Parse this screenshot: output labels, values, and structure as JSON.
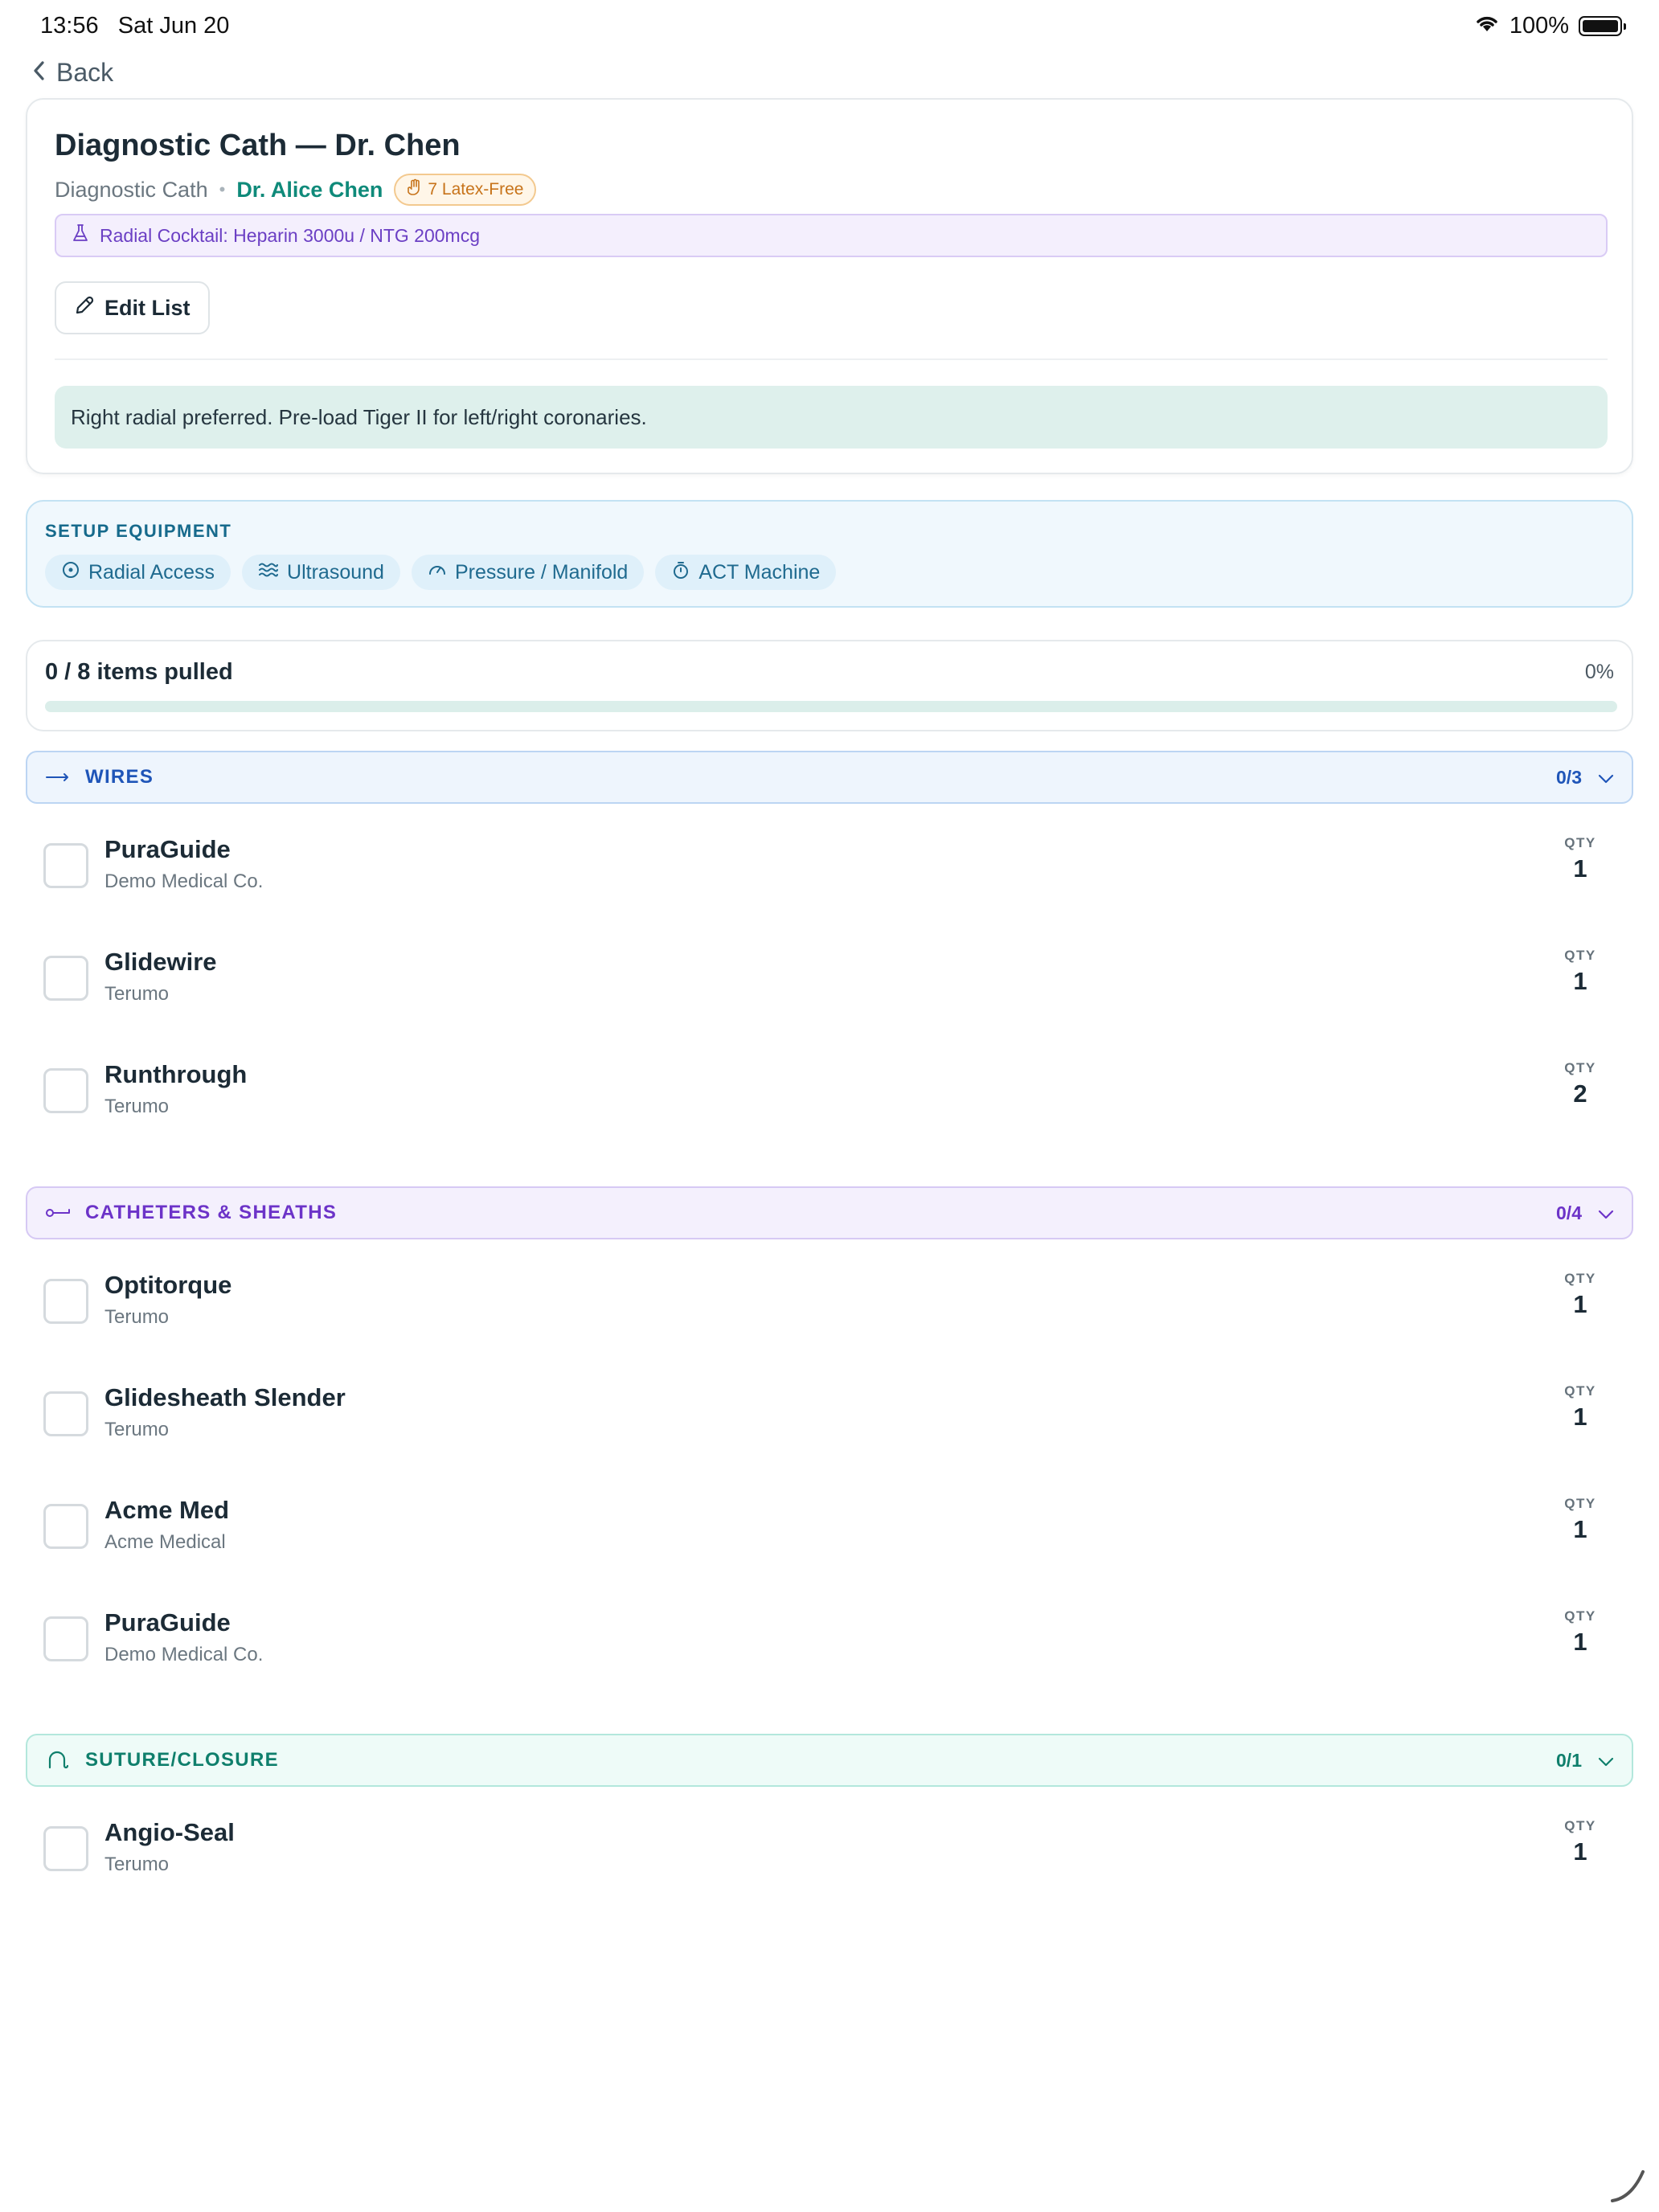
{
  "status_bar": {
    "time": "13:56",
    "date": "Sat Jun 20",
    "battery": "100%"
  },
  "nav": {
    "back_label": "Back"
  },
  "header": {
    "title": "Diagnostic Cath — Dr. Chen",
    "procedure_type": "Diagnostic Cath",
    "physician": "Dr. Alice Chen",
    "latex_badge": "7 Latex-Free",
    "cocktail": "Radial Cocktail: Heparin 3000u / NTG 200mcg",
    "edit_button": "Edit List",
    "note": "Right radial preferred. Pre-load Tiger II for left/right coronaries."
  },
  "setup_equipment": {
    "label": "SETUP EQUIPMENT",
    "chips": [
      {
        "label": "Radial Access",
        "icon": "circle-dot-icon"
      },
      {
        "label": "Ultrasound",
        "icon": "waves-icon"
      },
      {
        "label": "Pressure / Manifold",
        "icon": "gauge-icon"
      },
      {
        "label": "ACT Machine",
        "icon": "timer-icon"
      }
    ]
  },
  "progress": {
    "text": "0 / 8 items pulled",
    "percent_label": "0%",
    "fraction": 0
  },
  "qty_label": "QTY",
  "sections": [
    {
      "title": "WIRES",
      "count": "0/3",
      "color": "#1f55b8",
      "items": [
        {
          "name": "PuraGuide",
          "maker": "Demo Medical Co.",
          "qty": "1"
        },
        {
          "name": "Glidewire",
          "maker": "Terumo",
          "qty": "1"
        },
        {
          "name": "Runthrough",
          "maker": "Terumo",
          "qty": "2"
        }
      ]
    },
    {
      "title": "CATHETERS & SHEATHS",
      "count": "0/4",
      "color": "#6c33c8",
      "items": [
        {
          "name": "Optitorque",
          "maker": "Terumo",
          "qty": "1"
        },
        {
          "name": "Glidesheath Slender",
          "maker": "Terumo",
          "qty": "1"
        },
        {
          "name": "Acme Med",
          "maker": "Acme Medical",
          "qty": "1"
        },
        {
          "name": "PuraGuide",
          "maker": "Demo Medical Co.",
          "qty": "1"
        }
      ]
    },
    {
      "title": "SUTURE/CLOSURE",
      "count": "0/1",
      "color": "#0f7f6c",
      "items": [
        {
          "name": "Angio-Seal",
          "maker": "Terumo",
          "qty": "1"
        }
      ]
    }
  ]
}
